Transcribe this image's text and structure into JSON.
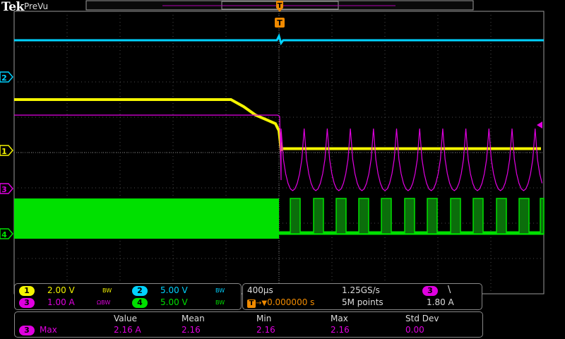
{
  "header": {
    "brand": "Tek",
    "mode": "PreVu"
  },
  "colors": {
    "ch1": "#f4f400",
    "ch2": "#00d2ff",
    "ch3": "#e000e0",
    "ch4": "#00e000",
    "trigger": "#f08a00",
    "grid": "#4a4a4a",
    "frame": "#9a9a9a"
  },
  "channels": [
    {
      "num": "1",
      "scale": "2.00 V",
      "bw": "BW"
    },
    {
      "num": "2",
      "scale": "5.00 V",
      "bw": "BW"
    },
    {
      "num": "3",
      "scale": "1.00 A",
      "bw": "ΩBW"
    },
    {
      "num": "4",
      "scale": "5.00 V",
      "bw": "BW"
    }
  ],
  "markers": {
    "ch1": "1",
    "ch2": "2",
    "ch3": "3",
    "ch4": "4",
    "trigger": "T"
  },
  "timebase": {
    "horizontal_scale": "400µs",
    "sample_rate": "1.25GS/s",
    "trigger_position": "0.000000 s",
    "record_length": "5M points",
    "trigger_source": "3",
    "trigger_slope_icon": "falling-edge-icon",
    "trigger_slope_glyph": "\\",
    "trigger_level": "1.80 A"
  },
  "measurements": {
    "headers": [
      "Value",
      "Mean",
      "Min",
      "Max",
      "Std Dev"
    ],
    "rows": [
      {
        "channel": "3",
        "type": "Max",
        "value": "2.16 A",
        "mean": "2.16",
        "min": "2.16",
        "max": "2.16",
        "std_dev": "0.00"
      }
    ]
  }
}
